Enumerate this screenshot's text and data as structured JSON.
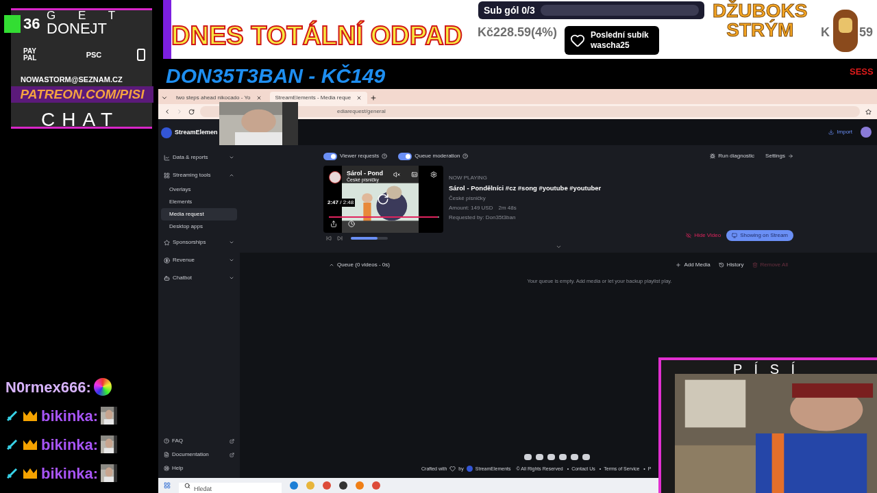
{
  "overlay_left": {
    "kofi_count": "36",
    "get_label": "G E T",
    "donate_label": "DONEJT",
    "payments": [
      {
        "kind": "paypal",
        "label": "PAY PAL"
      },
      {
        "kind": "psc",
        "label": "PSC"
      },
      {
        "kind": "sms"
      }
    ],
    "email": "NOWASTORM@SEZNAM.CZ",
    "patreon": "PATREON.COM/PISI",
    "chat_label": "CHAT"
  },
  "banner": {
    "title": "DNES TOTÁLNÍ ODPAD",
    "sub_goal": {
      "label": "Sub gól 0/3",
      "level": 0
    },
    "amount": "Kč228.59(4%)",
    "last_sub": {
      "label": "Poslední subík",
      "name": "wascha25"
    },
    "jukebox": [
      "DŽUBOKS",
      "STRÝM"
    ],
    "amount_right_start": "K",
    "amount_right_end": "59",
    "ticker": "DON35T3BAN - KČ149",
    "ticker_right": "SESS"
  },
  "browser": {
    "tabs": [
      {
        "title": "two steps ahead nikocado - Yo",
        "selected": false
      },
      {
        "title": "StreamElements - Media reque",
        "selected": true
      }
    ],
    "url": "ediarequest/general"
  },
  "sidebar": {
    "brand": "StreamElemen",
    "items": [
      {
        "label": "Data & reports",
        "expanded": false
      },
      {
        "label": "Streaming tools",
        "expanded": true,
        "children": [
          {
            "label": "Overlays",
            "selected": false
          },
          {
            "label": "Elements",
            "selected": false
          },
          {
            "label": "Media request",
            "selected": true
          },
          {
            "label": "Desktop apps",
            "selected": false
          }
        ]
      },
      {
        "label": "Sponsorships",
        "expanded": false
      },
      {
        "label": "Revenue",
        "expanded": false
      },
      {
        "label": "Chatbot",
        "expanded": false
      }
    ],
    "bottom": [
      "FAQ",
      "Documentation",
      "Help"
    ]
  },
  "header": {
    "import": "Import"
  },
  "controls": {
    "toggles": [
      {
        "label": "Viewer requests",
        "on": true
      },
      {
        "label": "Queue moderation",
        "on": true
      }
    ],
    "run_diagnostic": "Run diagnostic",
    "settings": "Settings"
  },
  "player": {
    "video_title": "Sárol - Pond",
    "video_channel": "České písničky",
    "time": "2:47",
    "duration": "/ 2:48",
    "progress": {
      "level": 0.99
    },
    "volume": {
      "level": 0.72
    }
  },
  "now_playing": {
    "label": "NOW PLAYING",
    "title": "Sárol - Pondělníci #cz #song #youtube #youtuber",
    "channel": "České písničky",
    "amount": "Amount: 149 USD",
    "length": "2m 48s",
    "requested_by": "Requested by: Don35t3ban",
    "hide_video": "Hide Video",
    "showing": "Showing on Stream"
  },
  "queue": {
    "title": "Queue (0 videos - 0s)",
    "add_media": "Add Media",
    "history": "History",
    "remove_all": {
      "label": "Remove All",
      "disabled": true
    },
    "empty": "Your queue is empty. Add media or let your backup playlist play."
  },
  "footer": {
    "crafted": "Crafted with",
    "by": "by",
    "brand": "StreamElements",
    "rights": "© All Rights Reserved",
    "links": [
      "Contact Us",
      "Terms of Service",
      "P"
    ],
    "separator": "•"
  },
  "taskbar": {
    "search_placeholder": "Hledat"
  },
  "chat": [
    {
      "kind": "plain",
      "user": "N0rmex666:",
      "color": "#d8b4fe"
    },
    {
      "kind": "badged",
      "user": "bikinka:",
      "color": "#a855f7"
    },
    {
      "kind": "badged",
      "user": "bikinka:",
      "color": "#a855f7"
    },
    {
      "kind": "badged",
      "user": "bikinka:",
      "color": "#a855f7"
    }
  ],
  "webcam": {
    "label": "P Í S Í"
  }
}
